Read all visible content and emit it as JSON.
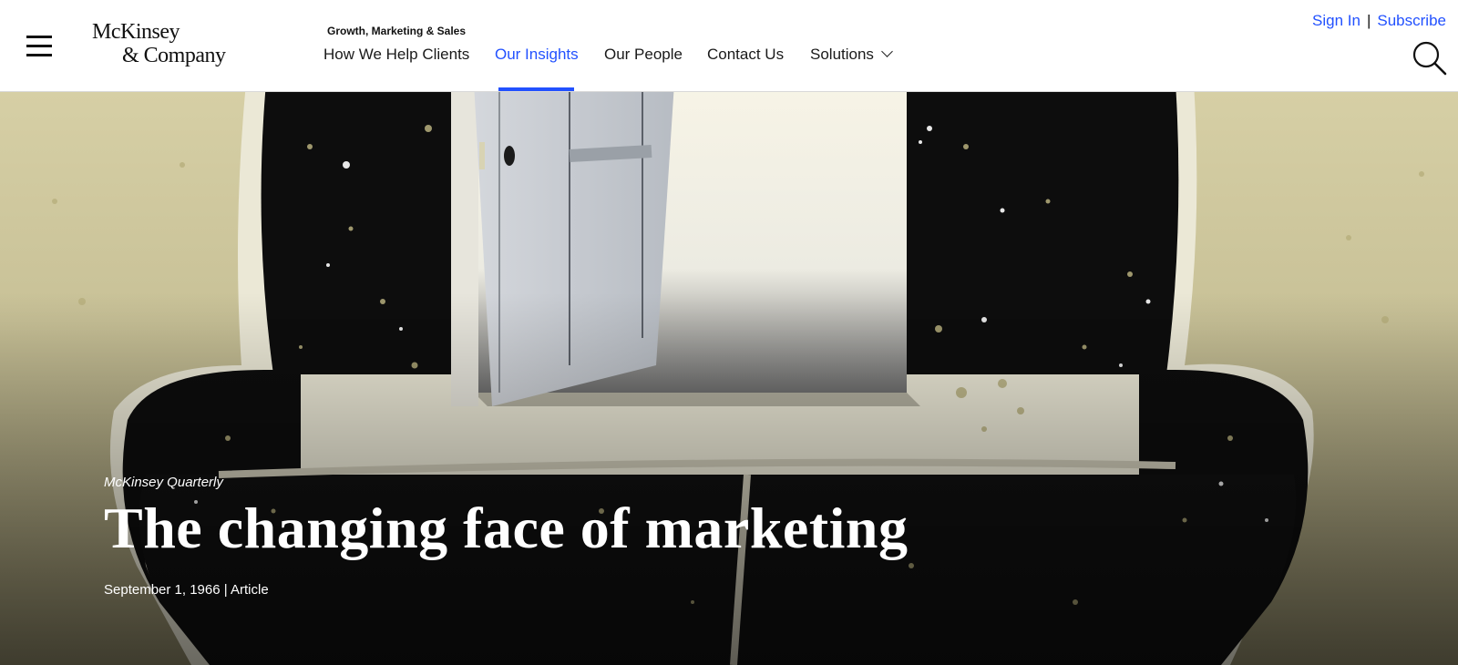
{
  "header": {
    "logo": {
      "line1": "McKinsey",
      "line2": "& Company"
    },
    "context_label": "Growth, Marketing & Sales",
    "nav": [
      {
        "label": "How We Help Clients"
      },
      {
        "label": "Our Insights"
      },
      {
        "label": "Our People"
      },
      {
        "label": "Contact Us"
      },
      {
        "label": "Solutions"
      }
    ],
    "active_nav": "Our Insights",
    "account": {
      "sign_in": "Sign In",
      "separator": "|",
      "subscribe": "Subscribe"
    },
    "icons": {
      "menu": "hamburger-menu-icon",
      "search": "search-icon",
      "dropdown": "chevron-down-icon"
    }
  },
  "hero": {
    "publication": "McKinsey Quarterly",
    "title": "The changing face of marketing",
    "meta": "September 1, 1966 | Article",
    "image": "illustration of an armchair with an open door in the backrest"
  },
  "colors": {
    "accent": "#2251ff",
    "text": "#111111",
    "hero_background": "#c9c29a",
    "chair": "#0d0d0d"
  }
}
